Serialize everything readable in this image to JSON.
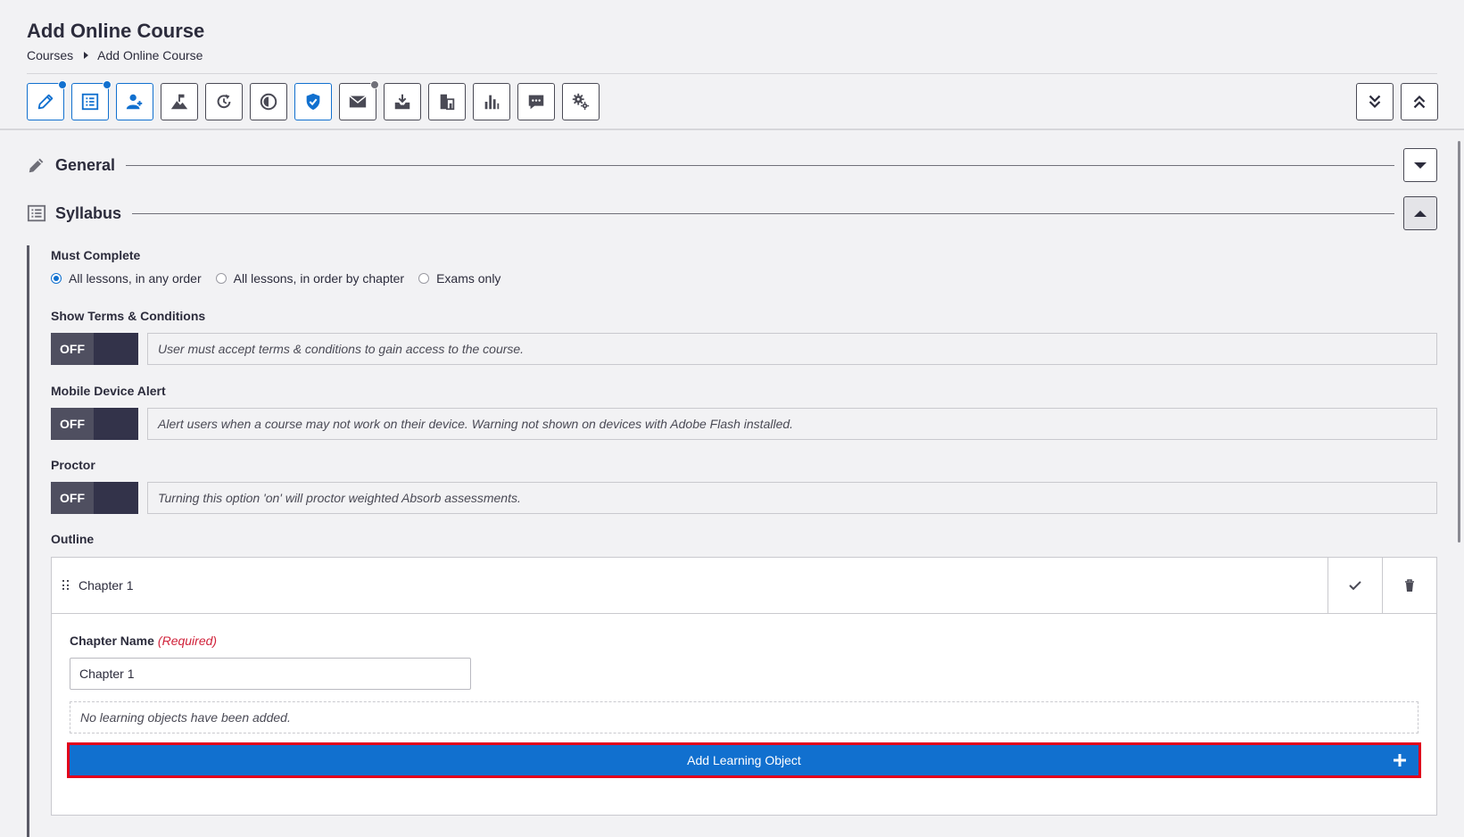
{
  "header": {
    "title": "Add Online Course",
    "breadcrumb": {
      "parent": "Courses",
      "current": "Add Online Course"
    }
  },
  "toolbar": {
    "tools": [
      {
        "icon": "pencil-icon",
        "active": true,
        "badge": "blue"
      },
      {
        "icon": "syllabus-icon",
        "active": true,
        "badge": "blue"
      },
      {
        "icon": "add-user-icon",
        "active": true
      },
      {
        "icon": "landscape-icon"
      },
      {
        "icon": "refresh-clock-icon"
      },
      {
        "icon": "circle-half-icon"
      },
      {
        "icon": "shield-check-icon",
        "active": true
      },
      {
        "icon": "envelope-icon",
        "badge": "grey"
      },
      {
        "icon": "inbox-download-icon"
      },
      {
        "icon": "building-icon"
      },
      {
        "icon": "bar-chart-icon"
      },
      {
        "icon": "chat-bubble-icon"
      },
      {
        "icon": "gears-icon"
      }
    ],
    "right_tools": [
      "collapse-all-icon",
      "expand-all-icon"
    ]
  },
  "sections": {
    "general": {
      "title": "General"
    },
    "syllabus": {
      "title": "Syllabus"
    }
  },
  "syllabus": {
    "must_complete": {
      "label": "Must Complete",
      "options": [
        "All lessons, in any order",
        "All lessons, in order by chapter",
        "Exams only"
      ],
      "selected": "All lessons, in any order"
    },
    "terms": {
      "label": "Show Terms & Conditions",
      "state": "OFF",
      "description": "User must accept terms & conditions to gain access to the course."
    },
    "mobile_alert": {
      "label": "Mobile Device Alert",
      "state": "OFF",
      "description": "Alert users when a course may not work on their device. Warning not shown on devices with Adobe Flash installed."
    },
    "proctor": {
      "label": "Proctor",
      "state": "OFF",
      "description": "Turning this option 'on' will proctor weighted Absorb assessments."
    },
    "outline": {
      "label": "Outline",
      "chapter_title": "Chapter 1",
      "chapter_name_label": "Chapter Name",
      "required_text": "(Required)",
      "chapter_name_value": "Chapter 1",
      "empty_message": "No learning objects have been added.",
      "add_button": "Add Learning Object"
    }
  },
  "colors": {
    "accent": "#1170cf",
    "highlight_border": "#e3001b",
    "toggle_off": "#4f4f60",
    "required": "#d0223a"
  }
}
